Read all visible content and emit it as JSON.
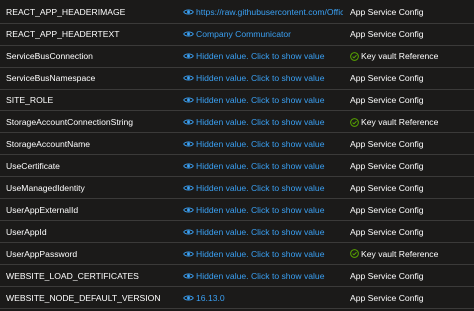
{
  "settings": {
    "rows": [
      {
        "name": "REACT_APP_HEADERIMAGE",
        "value": "https://raw.githubusercontent.com/Offic",
        "source": "App Service Config",
        "verified": false
      },
      {
        "name": "REACT_APP_HEADERTEXT",
        "value": "Company Communicator",
        "source": "App Service Config",
        "verified": false
      },
      {
        "name": "ServiceBusConnection",
        "value": "Hidden value. Click to show value",
        "source": "Key vault Reference",
        "verified": true
      },
      {
        "name": "ServiceBusNamespace",
        "value": "Hidden value. Click to show value",
        "source": "App Service Config",
        "verified": false
      },
      {
        "name": "SITE_ROLE",
        "value": "Hidden value. Click to show value",
        "source": "App Service Config",
        "verified": false
      },
      {
        "name": "StorageAccountConnectionString",
        "value": "Hidden value. Click to show value",
        "source": "Key vault Reference",
        "verified": true
      },
      {
        "name": "StorageAccountName",
        "value": "Hidden value. Click to show value",
        "source": "App Service Config",
        "verified": false
      },
      {
        "name": "UseCertificate",
        "value": "Hidden value. Click to show value",
        "source": "App Service Config",
        "verified": false
      },
      {
        "name": "UseManagedIdentity",
        "value": "Hidden value. Click to show value",
        "source": "App Service Config",
        "verified": false
      },
      {
        "name": "UserAppExternalId",
        "value": "Hidden value. Click to show value",
        "source": "App Service Config",
        "verified": false
      },
      {
        "name": "UserAppId",
        "value": "Hidden value. Click to show value",
        "source": "App Service Config",
        "verified": false
      },
      {
        "name": "UserAppPassword",
        "value": "Hidden value. Click to show value",
        "source": "Key vault Reference",
        "verified": true
      },
      {
        "name": "WEBSITE_LOAD_CERTIFICATES",
        "value": "Hidden value. Click to show value",
        "source": "App Service Config",
        "verified": false
      },
      {
        "name": "WEBSITE_NODE_DEFAULT_VERSION",
        "value": "16.13.0",
        "source": "App Service Config",
        "verified": false
      }
    ]
  },
  "icons": {
    "value_icon": "eye-icon",
    "source_icon": "check-circle-icon"
  },
  "colors": {
    "background": "#1b1a19",
    "text": "#ffffff",
    "link": "#3aa0f3",
    "success": "#57a300",
    "divider": "#3b3a39"
  }
}
